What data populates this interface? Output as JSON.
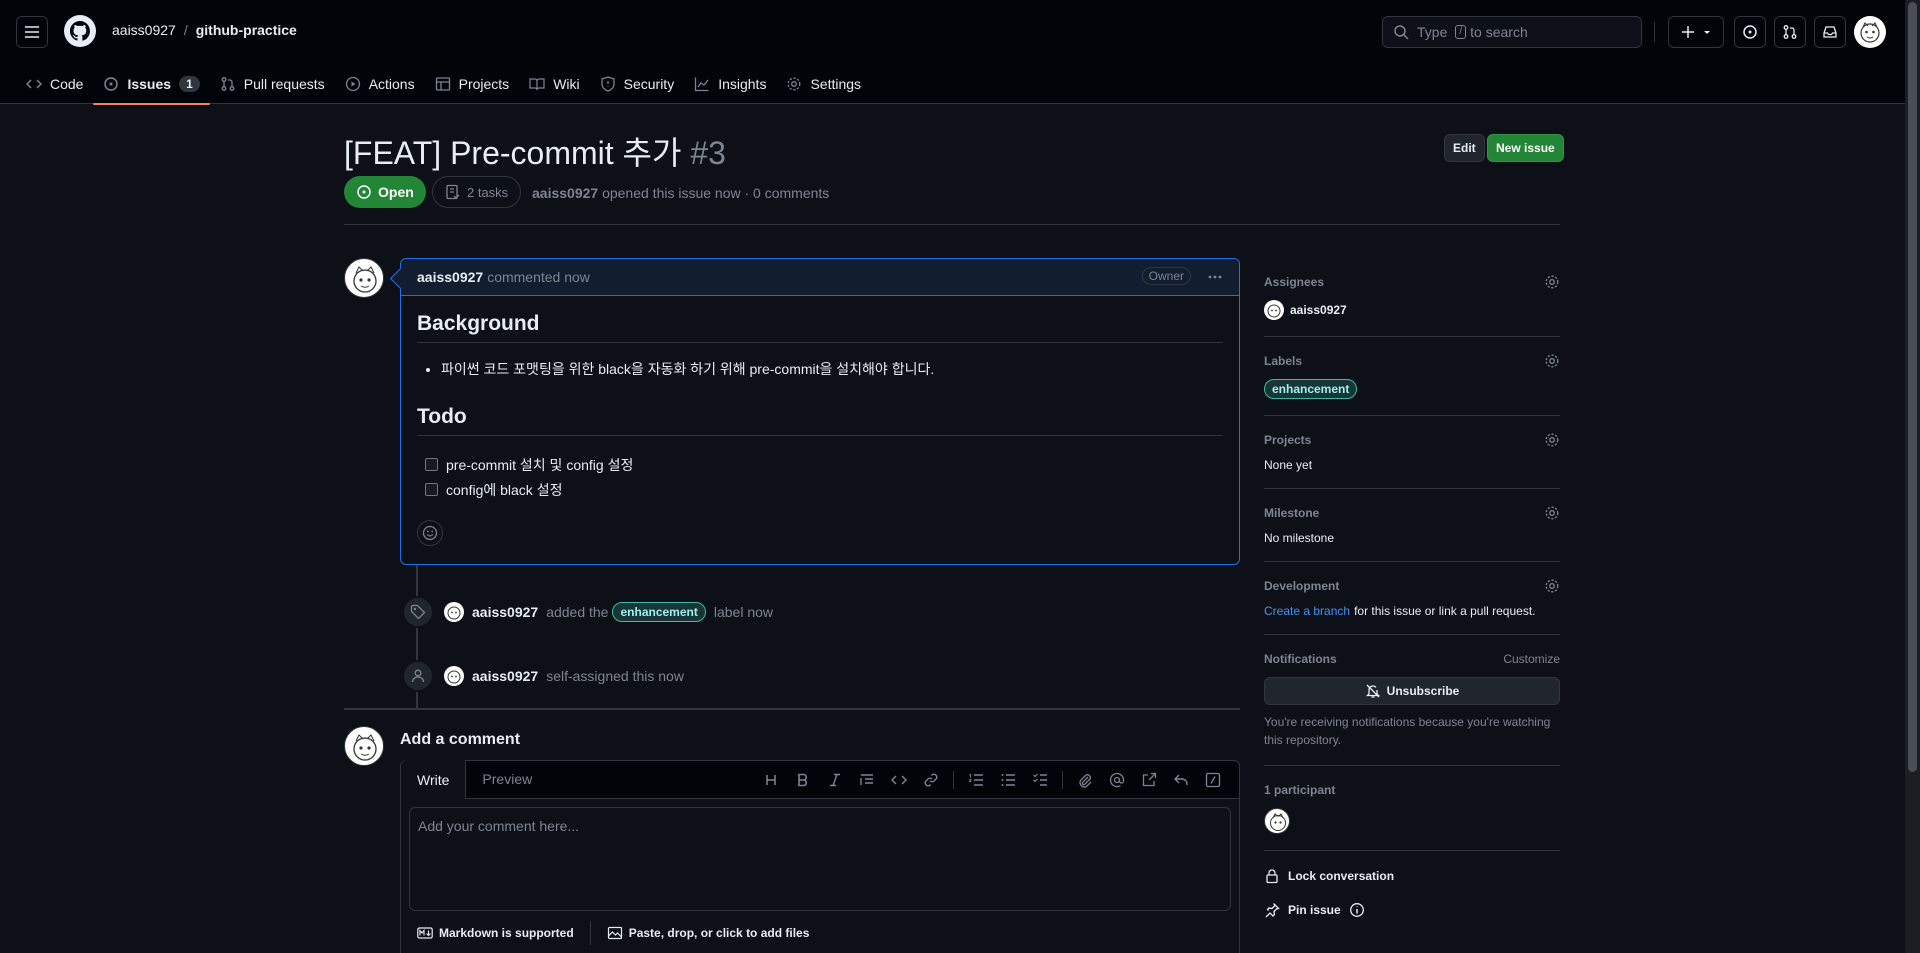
{
  "repo": {
    "owner": "aaiss0927",
    "separator": "/",
    "name": "github-practice"
  },
  "search": {
    "prefix": "Type",
    "key": "/",
    "suffix": "to search"
  },
  "nav": [
    {
      "label": "Code",
      "icon": "code-icon"
    },
    {
      "label": "Issues",
      "icon": "issue-opened-icon",
      "count": "1",
      "active": true
    },
    {
      "label": "Pull requests",
      "icon": "git-pull-request-icon"
    },
    {
      "label": "Actions",
      "icon": "play-icon"
    },
    {
      "label": "Projects",
      "icon": "table-icon"
    },
    {
      "label": "Wiki",
      "icon": "book-icon"
    },
    {
      "label": "Security",
      "icon": "shield-icon"
    },
    {
      "label": "Insights",
      "icon": "graph-icon"
    },
    {
      "label": "Settings",
      "icon": "gear-icon"
    }
  ],
  "issue": {
    "title": "[FEAT] Pre-commit 추가",
    "number": "#3",
    "edit_label": "Edit",
    "new_label": "New issue",
    "state": "Open",
    "tasks": "2 tasks",
    "author": "aaiss0927",
    "meta": "opened this issue now · 0 comments"
  },
  "comment": {
    "author": "aaiss0927",
    "when": "commented now",
    "badge": "Owner",
    "h_background": "Background",
    "bullet": "파이썬 코드 포맷팅을 위한 black을 자동화 하기 위해 pre-commit을 설치해야 합니다.",
    "h_todo": "Todo",
    "tasks": [
      "pre-commit 설치 및 config 설정",
      "config에 black 설정"
    ]
  },
  "timeline": [
    {
      "actor": "aaiss0927",
      "pre": "added the",
      "label": "enhancement",
      "post": "label now",
      "icon": "tag-icon"
    },
    {
      "actor": "aaiss0927",
      "text": "self-assigned this now",
      "icon": "person-icon"
    }
  ],
  "add_comment": {
    "title": "Add a comment",
    "tab_write": "Write",
    "tab_preview": "Preview",
    "placeholder": "Add your comment here...",
    "markdown": "Markdown is supported",
    "attach": "Paste, drop, or click to add files"
  },
  "sidebar": {
    "assignees": {
      "heading": "Assignees",
      "value": "aaiss0927"
    },
    "labels": {
      "heading": "Labels",
      "value": "enhancement"
    },
    "projects": {
      "heading": "Projects",
      "value": "None yet"
    },
    "milestone": {
      "heading": "Milestone",
      "value": "No milestone"
    },
    "development": {
      "heading": "Development",
      "link": "Create a branch",
      "rest": "for this issue or link a pull request."
    },
    "notifications": {
      "heading": "Notifications",
      "customize": "Customize",
      "button": "Unsubscribe",
      "note": "You're receiving notifications because you're watching this repository."
    },
    "participants": {
      "heading": "1 participant"
    },
    "lock": "Lock conversation",
    "pin": "Pin issue"
  },
  "colors": {
    "accent_green": "#238636",
    "link_blue": "#4493f8",
    "nav_underline": "#f78166",
    "label_teal": "#3fb9a7"
  }
}
